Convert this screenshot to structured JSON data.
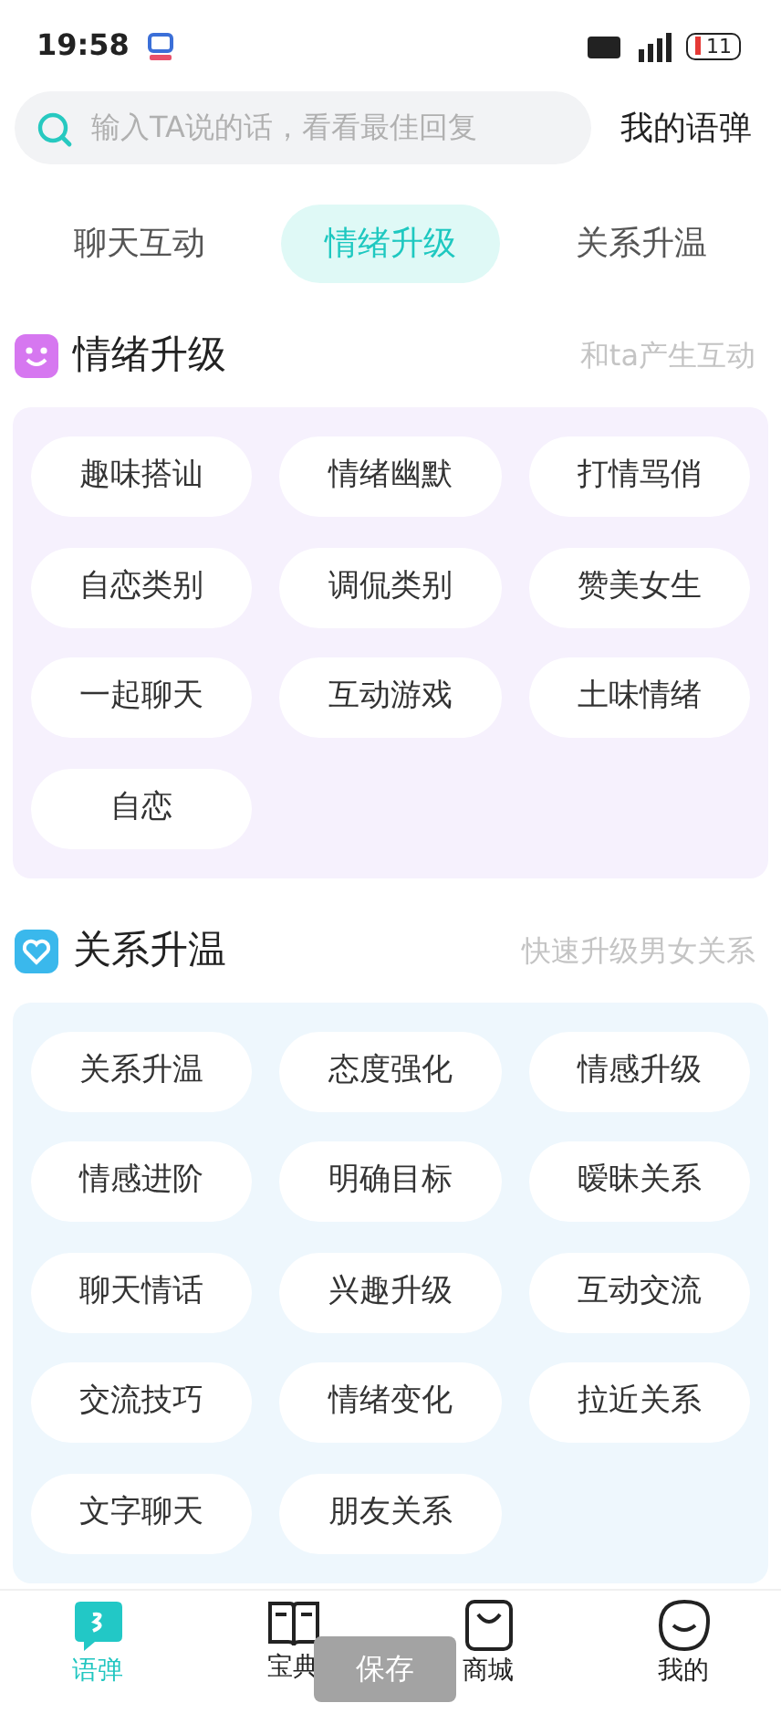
{
  "status_bar": {
    "time": "19:58",
    "battery": "11"
  },
  "search": {
    "placeholder": "输入TA说的话，看看最佳回复",
    "link": "我的语弹"
  },
  "tabs": [
    {
      "label": "聊天互动",
      "selected": false
    },
    {
      "label": "情绪升级",
      "selected": true
    },
    {
      "label": "关系升温",
      "selected": false
    }
  ],
  "sections": [
    {
      "kind": "smile",
      "title": "情绪升级",
      "subtitle": "和ta产生互动",
      "chips": [
        "趣味搭讪",
        "情绪幽默",
        "打情骂俏",
        "自恋类别",
        "调侃类别",
        "赞美女生",
        "一起聊天",
        "互动游戏",
        "土味情绪",
        "自恋"
      ]
    },
    {
      "kind": "heart",
      "title": "关系升温",
      "subtitle": "快速升级男女关系",
      "chips": [
        "关系升温",
        "态度强化",
        "情感升级",
        "情感进阶",
        "明确目标",
        "暧昧关系",
        "聊天情话",
        "兴趣升级",
        "互动交流",
        "交流技巧",
        "情绪变化",
        "拉近关系",
        "文字聊天",
        "朋友关系"
      ]
    }
  ],
  "bottom_nav": [
    {
      "kind": "chat",
      "label": "语弹",
      "selected": true
    },
    {
      "kind": "book",
      "label": "宝典",
      "selected": false
    },
    {
      "kind": "bag",
      "label": "商城",
      "selected": false
    },
    {
      "kind": "face",
      "label": "我的",
      "selected": false
    }
  ],
  "toast": "保存"
}
